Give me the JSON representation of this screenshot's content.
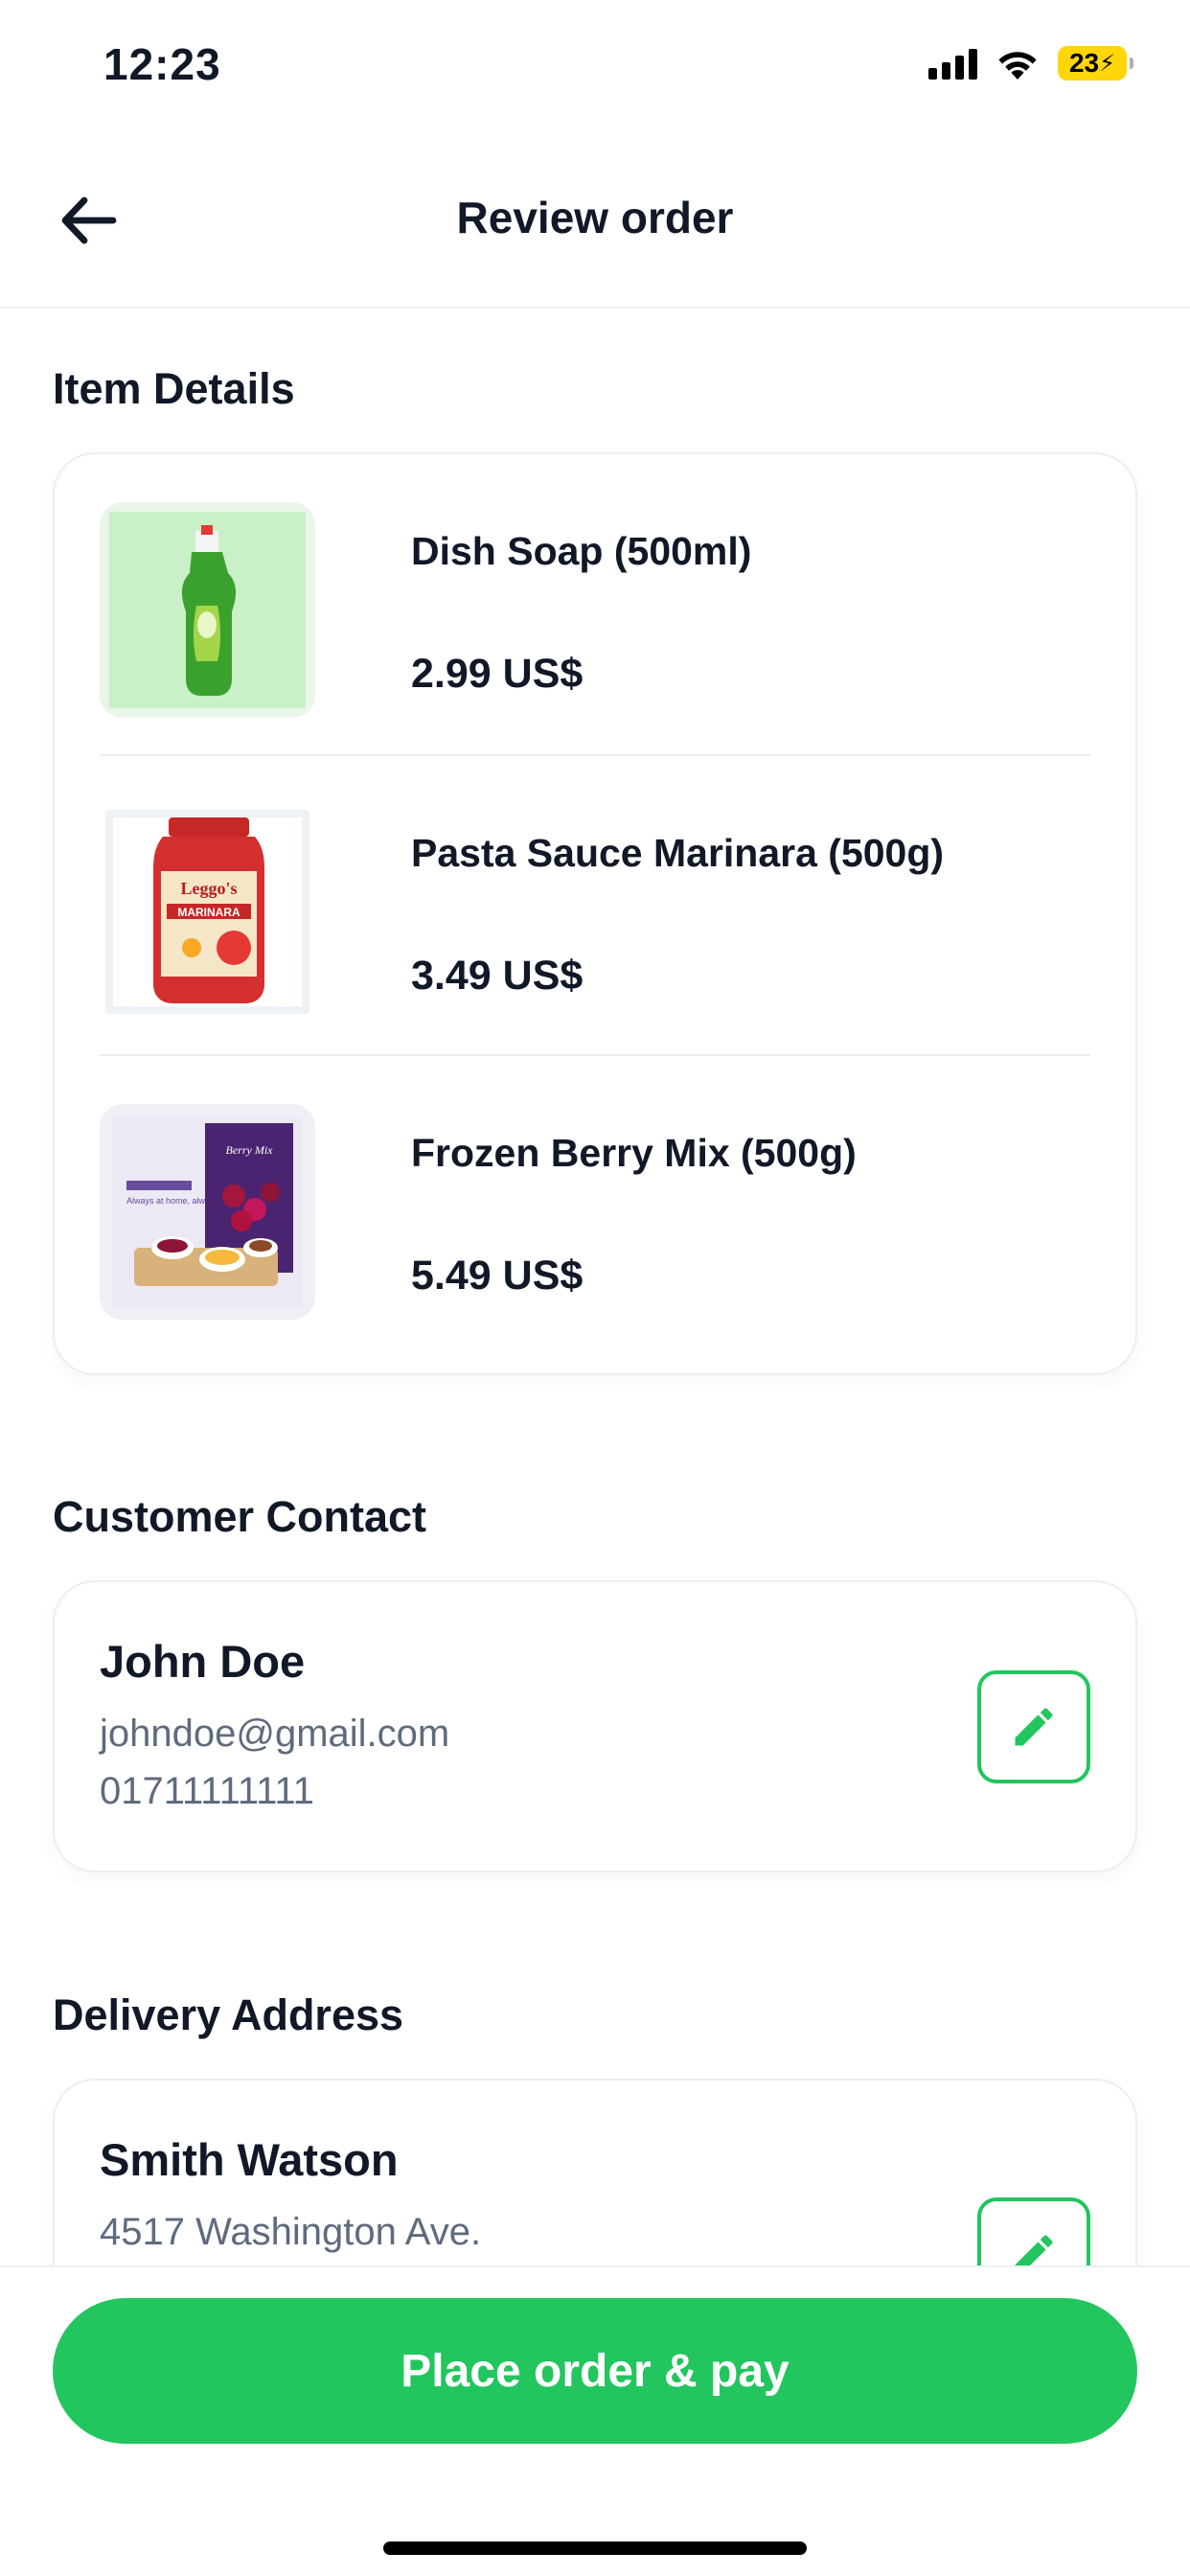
{
  "status_bar": {
    "time": "12:23",
    "battery": "23"
  },
  "header": {
    "title": "Review order"
  },
  "item_details": {
    "title": "Item Details",
    "items": [
      {
        "name": "Dish Soap (500ml)",
        "price": "2.99 US$",
        "image_icon": "dish-soap-bottle"
      },
      {
        "name": "Pasta Sauce Marinara (500g)",
        "price": "3.49 US$",
        "image_icon": "pasta-sauce-jar"
      },
      {
        "name": "Frozen Berry Mix (500g)",
        "price": "5.49 US$",
        "image_icon": "berry-mix-pack"
      }
    ],
    "product_labels": {
      "sauce_brand": "Leggo's",
      "sauce_type": "MARINARA",
      "berry_pack": "Berry Mix",
      "berry_ad": "Always at home, always at season"
    }
  },
  "customer_contact": {
    "title": "Customer Contact",
    "name": "John Doe",
    "email": "johndoe@gmail.com",
    "phone": "01711111111"
  },
  "delivery_address": {
    "title": "Delivery Address",
    "name": "Smith Watson",
    "address": "4517 Washington Ave."
  },
  "footer": {
    "button_label": "Place order & pay"
  },
  "colors": {
    "accent": "#22c55e",
    "text": "#111827",
    "muted": "#5f6b7d",
    "border": "#eceef2"
  }
}
